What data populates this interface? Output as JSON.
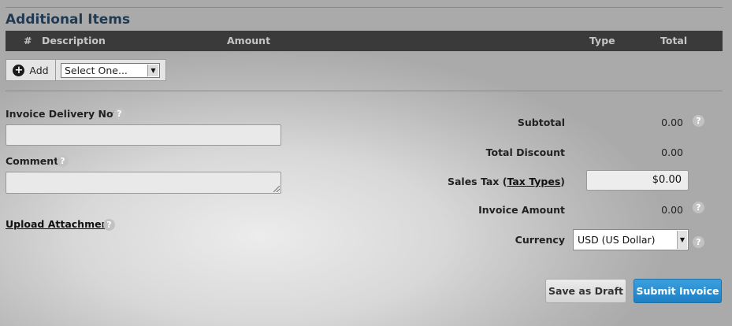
{
  "additional_items": {
    "title": "Additional Items",
    "columns": {
      "num": "#",
      "description": "Description",
      "amount": "Amount",
      "type": "Type",
      "total": "Total"
    },
    "add_label": "Add",
    "select_value": "Select One..."
  },
  "form": {
    "delivery_note_label": "Invoice Delivery Note",
    "delivery_note_value": "",
    "comment_label": "Comment",
    "comment_value": "",
    "upload_label": "Upload Attachment"
  },
  "summary": {
    "subtotal_label": "Subtotal",
    "subtotal_value": "0.00",
    "total_discount_label": "Total Discount",
    "total_discount_value": "0.00",
    "sales_tax_label": "Sales Tax (",
    "tax_types_link": "Tax Types",
    "sales_tax_label_end": ")",
    "sales_tax_value": "$0.00",
    "invoice_amount_label": "Invoice Amount",
    "invoice_amount_value": "0.00",
    "currency_label": "Currency",
    "currency_value": "USD (US Dollar)"
  },
  "actions": {
    "save_draft": "Save as Draft",
    "submit": "Submit Invoice"
  },
  "icons": {
    "help": "?",
    "plus": "+",
    "dropdown": "▼"
  },
  "colors": {
    "title": "#1f3a52",
    "submit": "#1f80c4",
    "table_header": "#3a3a3a"
  }
}
